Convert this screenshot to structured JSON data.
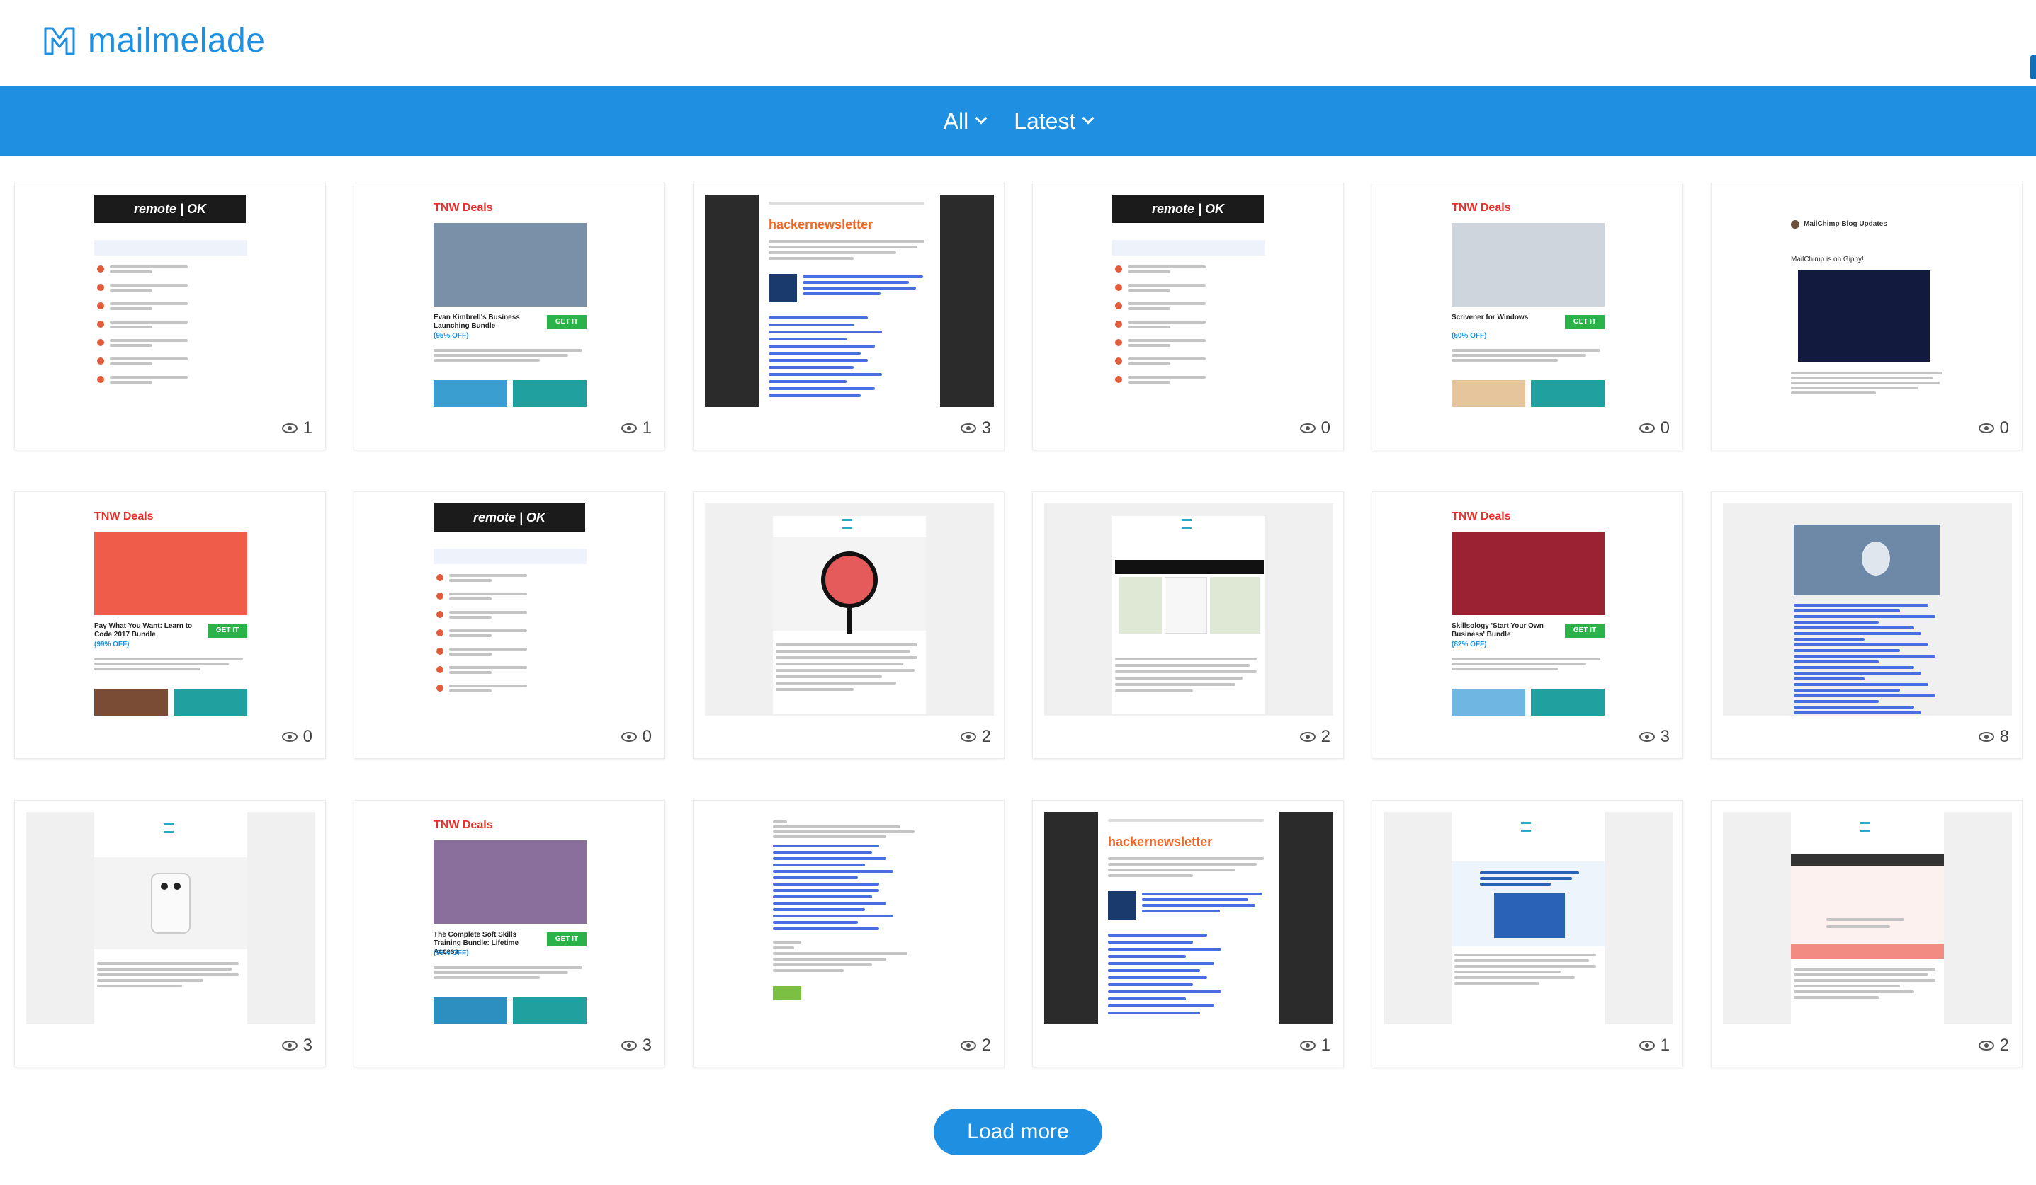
{
  "brand": {
    "name": "mailmelade",
    "accent": "#1e8fe1"
  },
  "nav": [
    {
      "label": "All"
    },
    {
      "label": "Latest"
    }
  ],
  "cards": [
    {
      "views": "1",
      "thumb": "remoteok"
    },
    {
      "views": "1",
      "thumb": "tnw-business"
    },
    {
      "views": "3",
      "thumb": "hackernews"
    },
    {
      "views": "0",
      "thumb": "remoteok"
    },
    {
      "views": "0",
      "thumb": "tnw-scrivener"
    },
    {
      "views": "0",
      "thumb": "mailchimp"
    },
    {
      "views": "0",
      "thumb": "tnw-code"
    },
    {
      "views": "0",
      "thumb": "remoteok"
    },
    {
      "views": "2",
      "thumb": "alarm"
    },
    {
      "views": "2",
      "thumb": "map"
    },
    {
      "views": "3",
      "thumb": "tnw-skillsology"
    },
    {
      "views": "8",
      "thumb": "apple"
    },
    {
      "views": "3",
      "thumb": "device"
    },
    {
      "views": "3",
      "thumb": "tnw-softskills"
    },
    {
      "views": "2",
      "thumb": "textlinks"
    },
    {
      "views": "1",
      "thumb": "hackernews"
    },
    {
      "views": "1",
      "thumb": "startup"
    },
    {
      "views": "2",
      "thumb": "pink"
    }
  ],
  "thumb_text": {
    "remoteok": {
      "banner": "remote | OK"
    },
    "tnw": {
      "brand": "TNW Deals",
      "cta": "GET IT"
    },
    "tnw-business": {
      "title": "Evan Kimbrell's Business Launching Bundle",
      "discount": "(95% OFF)"
    },
    "tnw-scrivener": {
      "title": "Scrivener for Windows",
      "discount": "(50% OFF)"
    },
    "tnw-code": {
      "title": "Pay What You Want: Learn to Code 2017 Bundle",
      "discount": "(99% OFF)"
    },
    "tnw-skillsology": {
      "title": "Skillsology 'Start Your Own Business' Bundle",
      "discount": "(82% OFF)"
    },
    "tnw-softskills": {
      "title": "The Complete Soft Skills Training Bundle: Lifetime Access",
      "discount": "(99% OFF)"
    },
    "hackernews": {
      "hn1": "hacker",
      "hn2": "news",
      "hn3": "letter"
    },
    "mailchimp": {
      "header": "MailChimp Blog Updates",
      "subtitle": "MailChimp is on Giphy!"
    }
  },
  "load_more": {
    "label": "Load more"
  }
}
